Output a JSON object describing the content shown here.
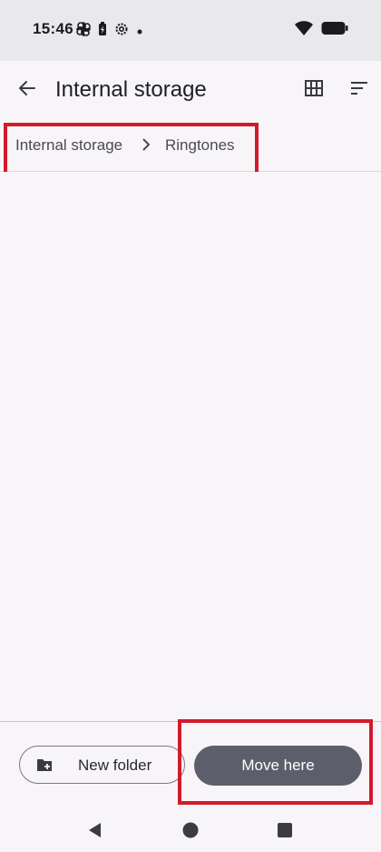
{
  "status_bar": {
    "time": "15:46",
    "left_icons": [
      "pinwheel-icon",
      "battery-saver-icon",
      "settings-icon",
      "notification-dot-icon"
    ],
    "right_icons": [
      "wifi-icon",
      "battery-icon"
    ]
  },
  "app_bar": {
    "title": "Internal storage",
    "back_icon": "arrow-back-icon",
    "grid_icon": "grid-view-icon",
    "sort_icon": "sort-icon"
  },
  "breadcrumb": {
    "items": [
      {
        "label": "Internal storage"
      },
      {
        "label": "Ringtones"
      }
    ],
    "separator_icon": "chevron-right-icon"
  },
  "actions": {
    "new_folder_label": "New folder",
    "new_folder_icon": "create-folder-icon",
    "move_here_label": "Move here"
  },
  "nav": {
    "back_icon": "nav-back-icon",
    "home_icon": "nav-home-icon",
    "recents_icon": "nav-recents-icon"
  },
  "colors": {
    "accent": "#5c5f6b",
    "highlight": "#d31a2b",
    "background": "#f8f5f8",
    "status_bar": "#e9e9eb"
  }
}
